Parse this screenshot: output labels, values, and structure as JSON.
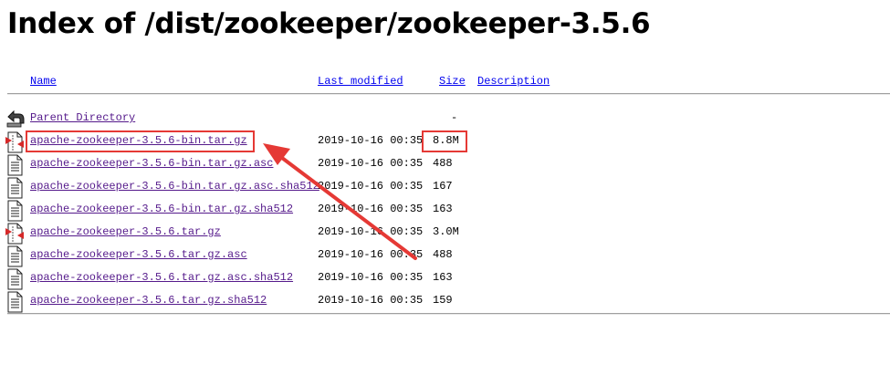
{
  "page": {
    "title": "Index of /dist/zookeeper/zookeeper-3.5.6"
  },
  "columns": {
    "name": "Name",
    "last_modified": "Last modified",
    "size": "Size",
    "description": "Description"
  },
  "parent": {
    "label": "Parent Directory",
    "size": "-"
  },
  "files": [
    {
      "name": "apache-zookeeper-3.5.6-bin.tar.gz",
      "modified": "2019-10-16 00:35",
      "size": "8.8M",
      "icon": "archive-icon"
    },
    {
      "name": "apache-zookeeper-3.5.6-bin.tar.gz.asc",
      "modified": "2019-10-16 00:35",
      "size": "488",
      "icon": "text-file-icon"
    },
    {
      "name": "apache-zookeeper-3.5.6-bin.tar.gz.asc.sha512",
      "modified": "2019-10-16 00:35",
      "size": "167",
      "icon": "text-file-icon"
    },
    {
      "name": "apache-zookeeper-3.5.6-bin.tar.gz.sha512",
      "modified": "2019-10-16 00:35",
      "size": "163",
      "icon": "text-file-icon"
    },
    {
      "name": "apache-zookeeper-3.5.6.tar.gz",
      "modified": "2019-10-16 00:35",
      "size": "3.0M",
      "icon": "archive-icon"
    },
    {
      "name": "apache-zookeeper-3.5.6.tar.gz.asc",
      "modified": "2019-10-16 00:35",
      "size": "488",
      "icon": "text-file-icon"
    },
    {
      "name": "apache-zookeeper-3.5.6.tar.gz.asc.sha512",
      "modified": "2019-10-16 00:35",
      "size": "163",
      "icon": "text-file-icon"
    },
    {
      "name": "apache-zookeeper-3.5.6.tar.gz.sha512",
      "modified": "2019-10-16 00:35",
      "size": "159",
      "icon": "text-file-icon"
    }
  ],
  "annotation": {
    "color": "#e53935"
  }
}
